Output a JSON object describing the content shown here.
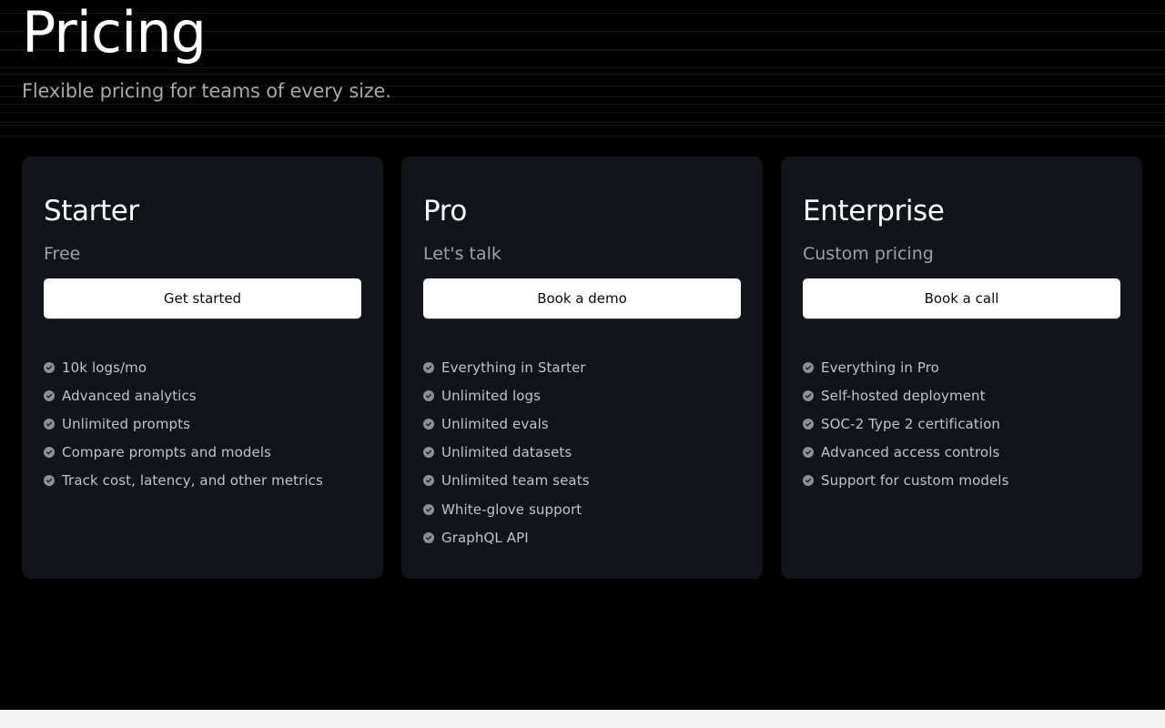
{
  "header": {
    "title": "Pricing",
    "subtitle": "Flexible pricing for teams of every size."
  },
  "colors": {
    "background": "#000000",
    "card": "#13141a",
    "button": "#ffffff",
    "check": "#8e8e94"
  },
  "plans": [
    {
      "name": "Starter",
      "price": "Free",
      "cta": "Get started",
      "features": [
        "10k logs/mo",
        "Advanced analytics",
        "Unlimited prompts",
        "Compare prompts and models",
        "Track cost, latency, and other metrics"
      ]
    },
    {
      "name": "Pro",
      "price": "Let's talk",
      "cta": "Book a demo",
      "features": [
        "Everything in Starter",
        "Unlimited logs",
        "Unlimited evals",
        "Unlimited datasets",
        "Unlimited team seats",
        "White-glove support",
        "GraphQL API"
      ]
    },
    {
      "name": "Enterprise",
      "price": "Custom pricing",
      "cta": "Book a call",
      "features": [
        "Everything in Pro",
        "Self-hosted deployment",
        "SOC-2 Type 2 certification",
        "Advanced access controls",
        "Support for custom models"
      ]
    }
  ],
  "icons": {
    "feature_check": "check-circle-icon"
  }
}
